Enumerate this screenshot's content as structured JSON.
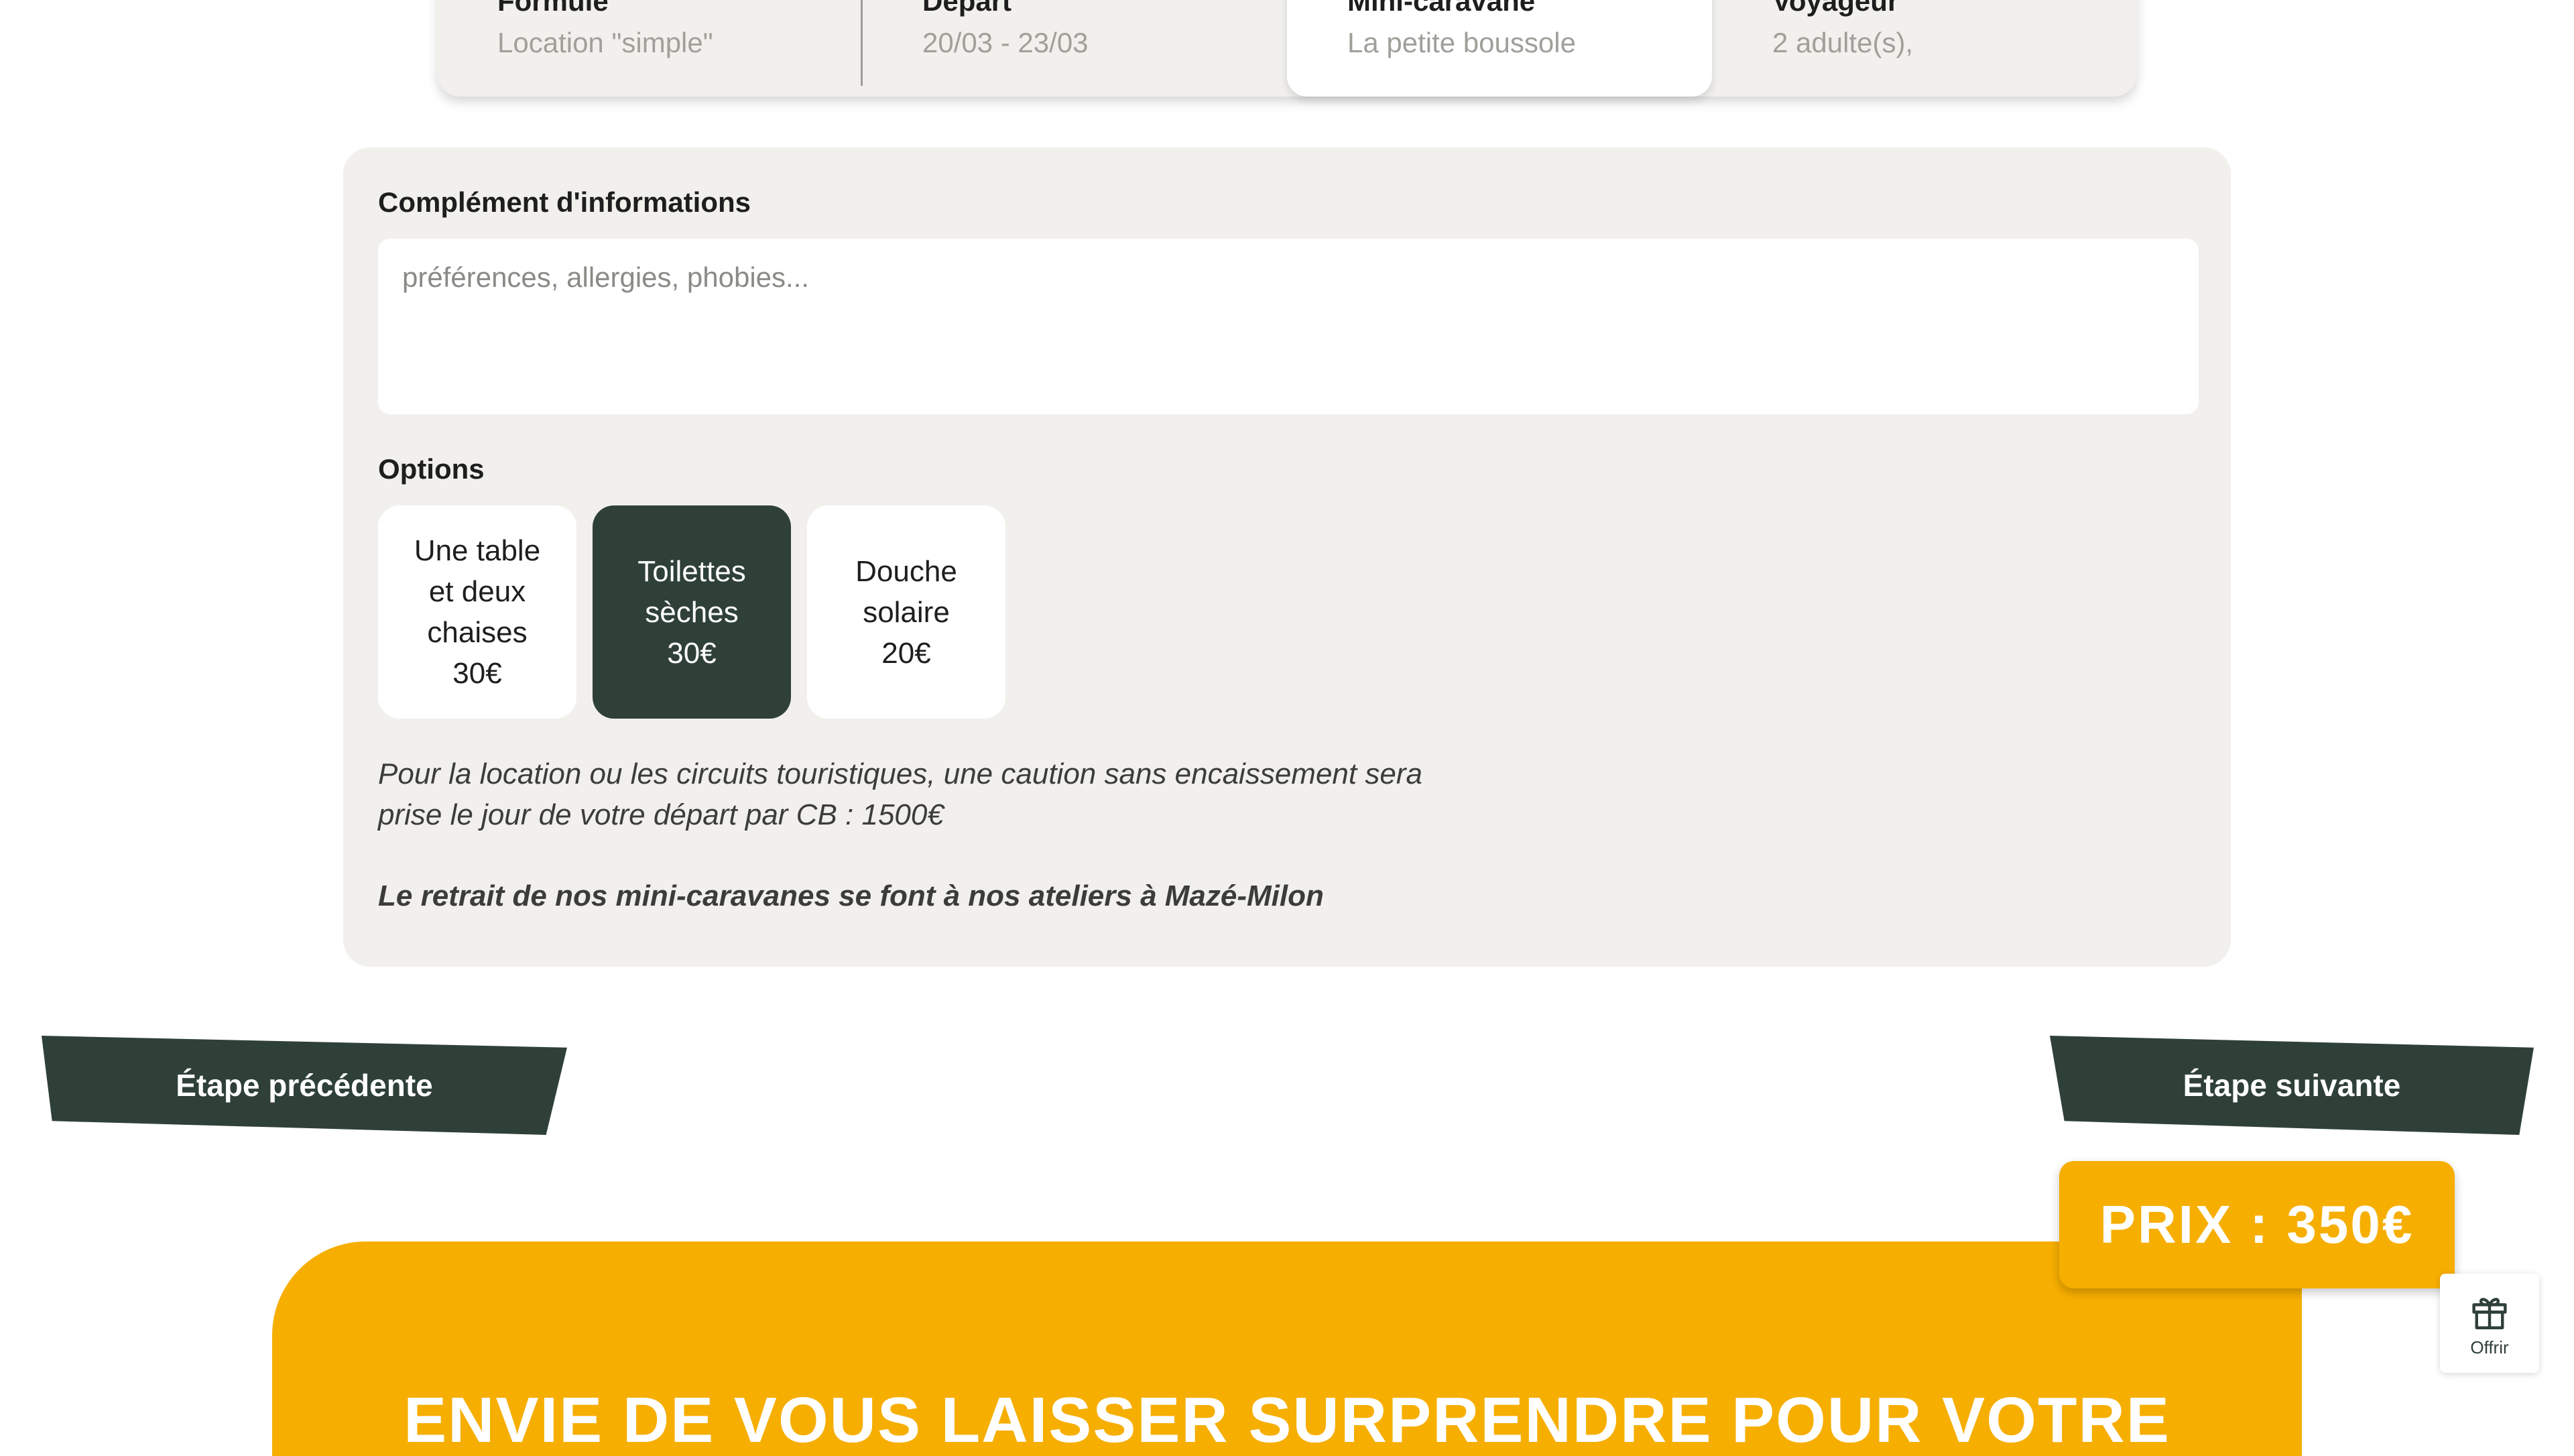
{
  "summary": {
    "items": [
      {
        "label": "Formule",
        "value": "Location \"simple\""
      },
      {
        "label": "Départ",
        "value": "20/03 - 23/03"
      },
      {
        "label": "Mini-caravane",
        "value": "La petite boussole"
      },
      {
        "label": "Voyageur",
        "value": "2 adulte(s),"
      }
    ]
  },
  "complement": {
    "title": "Complément d'informations",
    "placeholder": "préférences, allergies, phobies..."
  },
  "options": {
    "title": "Options",
    "items": [
      {
        "line1": "Une table",
        "line2": "et deux",
        "line3": "chaises",
        "price": "30€",
        "selected": false
      },
      {
        "line1": "Toilettes",
        "line2": "sèches",
        "price": "30€",
        "selected": true
      },
      {
        "line1": "Douche",
        "line2": "solaire",
        "price": "20€",
        "selected": false
      }
    ]
  },
  "notes": {
    "caution_line1": "Pour la location ou les circuits touristiques, une caution sans encaissement sera",
    "caution_line2": "prise le jour de votre départ par CB : 1500€",
    "retrait": "Le retrait de nos mini-caravanes se font à nos ateliers à Mazé-Milon"
  },
  "navigation": {
    "prev_label": "Étape précédente",
    "next_label": "Étape suivante"
  },
  "price": {
    "label": "PRIX : 350€"
  },
  "banner": {
    "text": "ENVIE DE VOUS LAISSER SURPRENDRE POUR VOTRE"
  },
  "gift": {
    "label": "Offrir",
    "icon": "gift-icon"
  },
  "colors": {
    "dark_green": "#2f4038",
    "accent_yellow": "#f6ae00",
    "panel_bg": "#f1f0ec"
  }
}
